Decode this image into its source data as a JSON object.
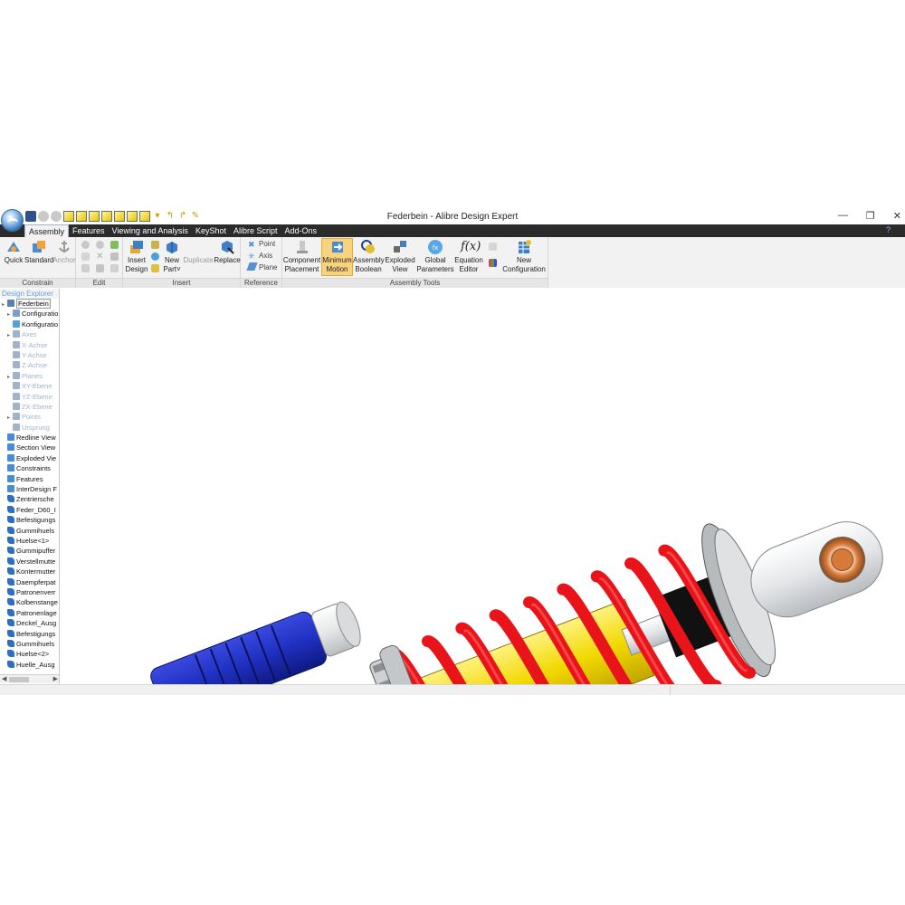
{
  "window": {
    "title": "Federbein - Alibre Design Expert",
    "controls": [
      "—",
      "❐",
      "✕"
    ]
  },
  "menu": {
    "tabs": [
      "Assembly",
      "Features",
      "Viewing and Analysis",
      "KeyShot",
      "Alibre Script",
      "Add-Ons"
    ],
    "active_tab": "Assembly",
    "help_icon": "help-icon"
  },
  "ribbon": {
    "groups": {
      "constrain": "Constrain",
      "edit": "Edit",
      "insert": "Insert",
      "reference": "Reference",
      "assembly_tools": "Assembly Tools"
    },
    "quick": "Quick",
    "standard": "Standard",
    "anchor": "Anchor",
    "insert_design": [
      "Insert",
      "Design"
    ],
    "new_part": [
      "New",
      "Part˅"
    ],
    "duplicate": "Duplicate",
    "replace": "Replace",
    "point": "Point",
    "axis": "Axis",
    "plane": "Plane",
    "component_placement": [
      "Component",
      "Placement"
    ],
    "minimum_motion": [
      "Minimum",
      "Motion"
    ],
    "assembly_boolean": [
      "Assembly",
      "Boolean"
    ],
    "exploded_view": [
      "Exploded",
      "View"
    ],
    "global_parameters": [
      "Global",
      "Parameters"
    ],
    "equation_editor": [
      "Equation",
      "Editor"
    ],
    "new_configuration": [
      "New",
      "Configuration"
    ]
  },
  "explorer": {
    "title": "Design Explorer",
    "items": [
      {
        "label": "Federbein",
        "type": "root"
      },
      {
        "label": "Configuration",
        "type": "node"
      },
      {
        "label": "Konfiguratio",
        "type": "child"
      },
      {
        "label": "Axes",
        "type": "faded-node"
      },
      {
        "label": "X-Achse",
        "type": "faded"
      },
      {
        "label": "Y-Achse",
        "type": "faded"
      },
      {
        "label": "Z-Achse",
        "type": "faded"
      },
      {
        "label": "Planes",
        "type": "faded-node"
      },
      {
        "label": "XY-Ebene",
        "type": "faded"
      },
      {
        "label": "YZ-Ebene",
        "type": "faded"
      },
      {
        "label": "ZX-Ebene",
        "type": "faded"
      },
      {
        "label": "Points",
        "type": "faded-node"
      },
      {
        "label": "Ursprung",
        "type": "faded"
      },
      {
        "label": "Redline View",
        "type": "item"
      },
      {
        "label": "Section View",
        "type": "item"
      },
      {
        "label": "Exploded Vie",
        "type": "item"
      },
      {
        "label": "Constraints",
        "type": "item"
      },
      {
        "label": "Features",
        "type": "item"
      },
      {
        "label": "InterDesign F",
        "type": "item"
      },
      {
        "label": "Zentriersche",
        "type": "part"
      },
      {
        "label": "Feder_D60_I",
        "type": "part"
      },
      {
        "label": "Befestigungs",
        "type": "part"
      },
      {
        "label": "Gummihuels",
        "type": "part"
      },
      {
        "label": "Huelse<1>",
        "type": "part"
      },
      {
        "label": "Gummipuffer",
        "type": "part"
      },
      {
        "label": "Verstellmutte",
        "type": "part"
      },
      {
        "label": "Kontermutter",
        "type": "part"
      },
      {
        "label": "Daempferpat",
        "type": "part"
      },
      {
        "label": "Patronenverr",
        "type": "part"
      },
      {
        "label": "Kolbenstange",
        "type": "part"
      },
      {
        "label": "Patronenlage",
        "type": "part"
      },
      {
        "label": "Deckel_Ausg",
        "type": "part"
      },
      {
        "label": "Befestigungs",
        "type": "part"
      },
      {
        "label": "Gummihuels",
        "type": "part"
      },
      {
        "label": "Huelse<2>",
        "type": "part"
      },
      {
        "label": "Huelle_Ausg",
        "type": "part"
      }
    ]
  },
  "colors": {
    "spring": "#e8141a",
    "reservoir": "#1f2fc0",
    "body": "#e6e8ea",
    "thread": "#b7b400",
    "bushing": "#d67a3c",
    "accent": "#2b2b2b"
  }
}
